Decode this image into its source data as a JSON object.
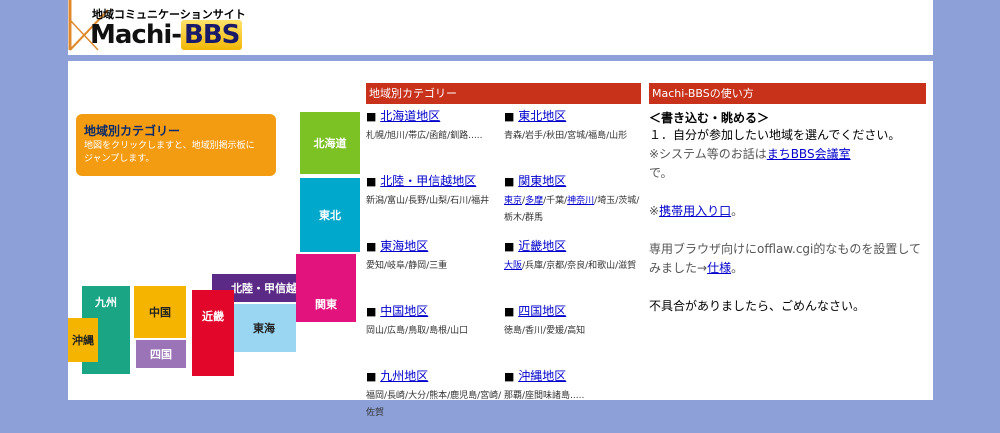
{
  "logo": {
    "subtitle": "地域コミュニケーションサイト",
    "name": "Machi-",
    "name_bbs": "BBS"
  },
  "map": {
    "callout": {
      "title": "地域別カテゴリー",
      "desc_line1": "地図をクリックしますと、地域別掲示板に",
      "desc_line2": "ジャンプします。"
    },
    "regions": {
      "hokkaido": "北海道",
      "tohoku": "東北",
      "hokuriku": "北陸・甲信越",
      "kanto": "関東",
      "tokai": "東海",
      "kinki": "近畿",
      "chugoku": "中国",
      "shikoku": "四国",
      "kyushu": "九州",
      "okinawa": "沖縄"
    }
  },
  "categories": {
    "header": "地域別カテゴリー",
    "items": [
      {
        "name": "北海道地区",
        "prefs": "札幌/旭川/帯広/函館/釧路....."
      },
      {
        "name": "東北地区",
        "prefs": "青森/岩手/秋田/宮城/福島/山形"
      },
      {
        "name": "北陸・甲信越地区",
        "prefs": "新潟/富山/長野/山梨/石川/福井"
      },
      {
        "name": "関東地区",
        "prefs_link1": "東京",
        "prefs_sep1": "/",
        "prefs_link2": "多摩",
        "prefs_mid": "/千葉/",
        "prefs_link3": "神奈川",
        "prefs_rest": "/埼玉/茨城/栃木/群馬"
      },
      {
        "name": "東海地区",
        "prefs": "愛知/岐阜/静岡/三重"
      },
      {
        "name": "近畿地区",
        "prefs_link1": "大阪",
        "prefs_rest": "/兵庫/京都/奈良/和歌山/滋賀"
      },
      {
        "name": "中国地区",
        "prefs": "岡山/広島/鳥取/島根/山口"
      },
      {
        "name": "四国地区",
        "prefs": "徳島/香川/愛媛/高知"
      },
      {
        "name": "九州地区",
        "prefs": "福岡/長崎/大分/熊本/鹿児島/宮崎/佐賀"
      },
      {
        "name": "沖縄地区",
        "prefs": "那覇/座間味諸島....."
      }
    ]
  },
  "howto": {
    "header": "Machi-BBSの使い方",
    "section": "＜書き込む・眺める＞",
    "step1": "１．自分が参加したい地域を選んでください。",
    "note_pre": "※システム等のお話は",
    "note_link": "まちBBS会議室",
    "note_post": "で。",
    "mobile_pre": "※",
    "mobile_link": "携帯用入り口",
    "mobile_post": "。",
    "browser_text": "専用ブラウザ向けにofflaw.cgi的なものを設置してみました→",
    "browser_link": "仕様",
    "browser_post": "。",
    "apology": "不具合がありましたら、ごめんなさい。"
  },
  "colors": {
    "hokkaido": "#7cc225",
    "tohoku": "#00a9cc",
    "hokuriku": "#5a2a86",
    "kanto": "#e2137c",
    "tokai": "#9ad6f2",
    "kinki": "#e2062b",
    "chugoku": "#f5b400",
    "shikoku": "#9b74b8",
    "kyushu": "#1aa585",
    "okinawa": "#f5b400",
    "bar": "#c8311a"
  }
}
